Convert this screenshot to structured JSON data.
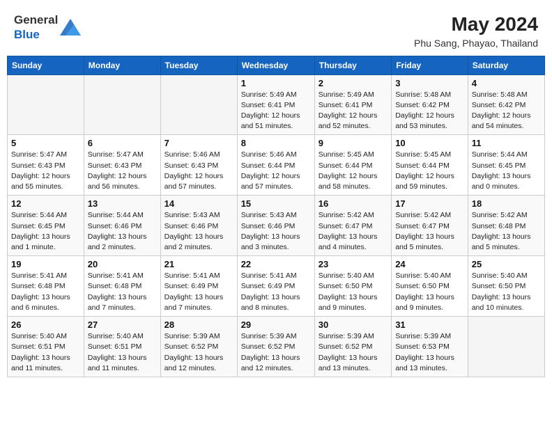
{
  "header": {
    "logo_general": "General",
    "logo_blue": "Blue",
    "month_year": "May 2024",
    "location": "Phu Sang, Phayao, Thailand"
  },
  "days_of_week": [
    "Sunday",
    "Monday",
    "Tuesday",
    "Wednesday",
    "Thursday",
    "Friday",
    "Saturday"
  ],
  "weeks": [
    [
      {
        "day": "",
        "info": ""
      },
      {
        "day": "",
        "info": ""
      },
      {
        "day": "",
        "info": ""
      },
      {
        "day": "1",
        "info": "Sunrise: 5:49 AM\nSunset: 6:41 PM\nDaylight: 12 hours and 51 minutes."
      },
      {
        "day": "2",
        "info": "Sunrise: 5:49 AM\nSunset: 6:41 PM\nDaylight: 12 hours and 52 minutes."
      },
      {
        "day": "3",
        "info": "Sunrise: 5:48 AM\nSunset: 6:42 PM\nDaylight: 12 hours and 53 minutes."
      },
      {
        "day": "4",
        "info": "Sunrise: 5:48 AM\nSunset: 6:42 PM\nDaylight: 12 hours and 54 minutes."
      }
    ],
    [
      {
        "day": "5",
        "info": "Sunrise: 5:47 AM\nSunset: 6:43 PM\nDaylight: 12 hours and 55 minutes."
      },
      {
        "day": "6",
        "info": "Sunrise: 5:47 AM\nSunset: 6:43 PM\nDaylight: 12 hours and 56 minutes."
      },
      {
        "day": "7",
        "info": "Sunrise: 5:46 AM\nSunset: 6:43 PM\nDaylight: 12 hours and 57 minutes."
      },
      {
        "day": "8",
        "info": "Sunrise: 5:46 AM\nSunset: 6:44 PM\nDaylight: 12 hours and 57 minutes."
      },
      {
        "day": "9",
        "info": "Sunrise: 5:45 AM\nSunset: 6:44 PM\nDaylight: 12 hours and 58 minutes."
      },
      {
        "day": "10",
        "info": "Sunrise: 5:45 AM\nSunset: 6:44 PM\nDaylight: 12 hours and 59 minutes."
      },
      {
        "day": "11",
        "info": "Sunrise: 5:44 AM\nSunset: 6:45 PM\nDaylight: 13 hours and 0 minutes."
      }
    ],
    [
      {
        "day": "12",
        "info": "Sunrise: 5:44 AM\nSunset: 6:45 PM\nDaylight: 13 hours and 1 minute."
      },
      {
        "day": "13",
        "info": "Sunrise: 5:44 AM\nSunset: 6:46 PM\nDaylight: 13 hours and 2 minutes."
      },
      {
        "day": "14",
        "info": "Sunrise: 5:43 AM\nSunset: 6:46 PM\nDaylight: 13 hours and 2 minutes."
      },
      {
        "day": "15",
        "info": "Sunrise: 5:43 AM\nSunset: 6:46 PM\nDaylight: 13 hours and 3 minutes."
      },
      {
        "day": "16",
        "info": "Sunrise: 5:42 AM\nSunset: 6:47 PM\nDaylight: 13 hours and 4 minutes."
      },
      {
        "day": "17",
        "info": "Sunrise: 5:42 AM\nSunset: 6:47 PM\nDaylight: 13 hours and 5 minutes."
      },
      {
        "day": "18",
        "info": "Sunrise: 5:42 AM\nSunset: 6:48 PM\nDaylight: 13 hours and 5 minutes."
      }
    ],
    [
      {
        "day": "19",
        "info": "Sunrise: 5:41 AM\nSunset: 6:48 PM\nDaylight: 13 hours and 6 minutes."
      },
      {
        "day": "20",
        "info": "Sunrise: 5:41 AM\nSunset: 6:48 PM\nDaylight: 13 hours and 7 minutes."
      },
      {
        "day": "21",
        "info": "Sunrise: 5:41 AM\nSunset: 6:49 PM\nDaylight: 13 hours and 7 minutes."
      },
      {
        "day": "22",
        "info": "Sunrise: 5:41 AM\nSunset: 6:49 PM\nDaylight: 13 hours and 8 minutes."
      },
      {
        "day": "23",
        "info": "Sunrise: 5:40 AM\nSunset: 6:50 PM\nDaylight: 13 hours and 9 minutes."
      },
      {
        "day": "24",
        "info": "Sunrise: 5:40 AM\nSunset: 6:50 PM\nDaylight: 13 hours and 9 minutes."
      },
      {
        "day": "25",
        "info": "Sunrise: 5:40 AM\nSunset: 6:50 PM\nDaylight: 13 hours and 10 minutes."
      }
    ],
    [
      {
        "day": "26",
        "info": "Sunrise: 5:40 AM\nSunset: 6:51 PM\nDaylight: 13 hours and 11 minutes."
      },
      {
        "day": "27",
        "info": "Sunrise: 5:40 AM\nSunset: 6:51 PM\nDaylight: 13 hours and 11 minutes."
      },
      {
        "day": "28",
        "info": "Sunrise: 5:39 AM\nSunset: 6:52 PM\nDaylight: 13 hours and 12 minutes."
      },
      {
        "day": "29",
        "info": "Sunrise: 5:39 AM\nSunset: 6:52 PM\nDaylight: 13 hours and 12 minutes."
      },
      {
        "day": "30",
        "info": "Sunrise: 5:39 AM\nSunset: 6:52 PM\nDaylight: 13 hours and 13 minutes."
      },
      {
        "day": "31",
        "info": "Sunrise: 5:39 AM\nSunset: 6:53 PM\nDaylight: 13 hours and 13 minutes."
      },
      {
        "day": "",
        "info": ""
      }
    ]
  ]
}
